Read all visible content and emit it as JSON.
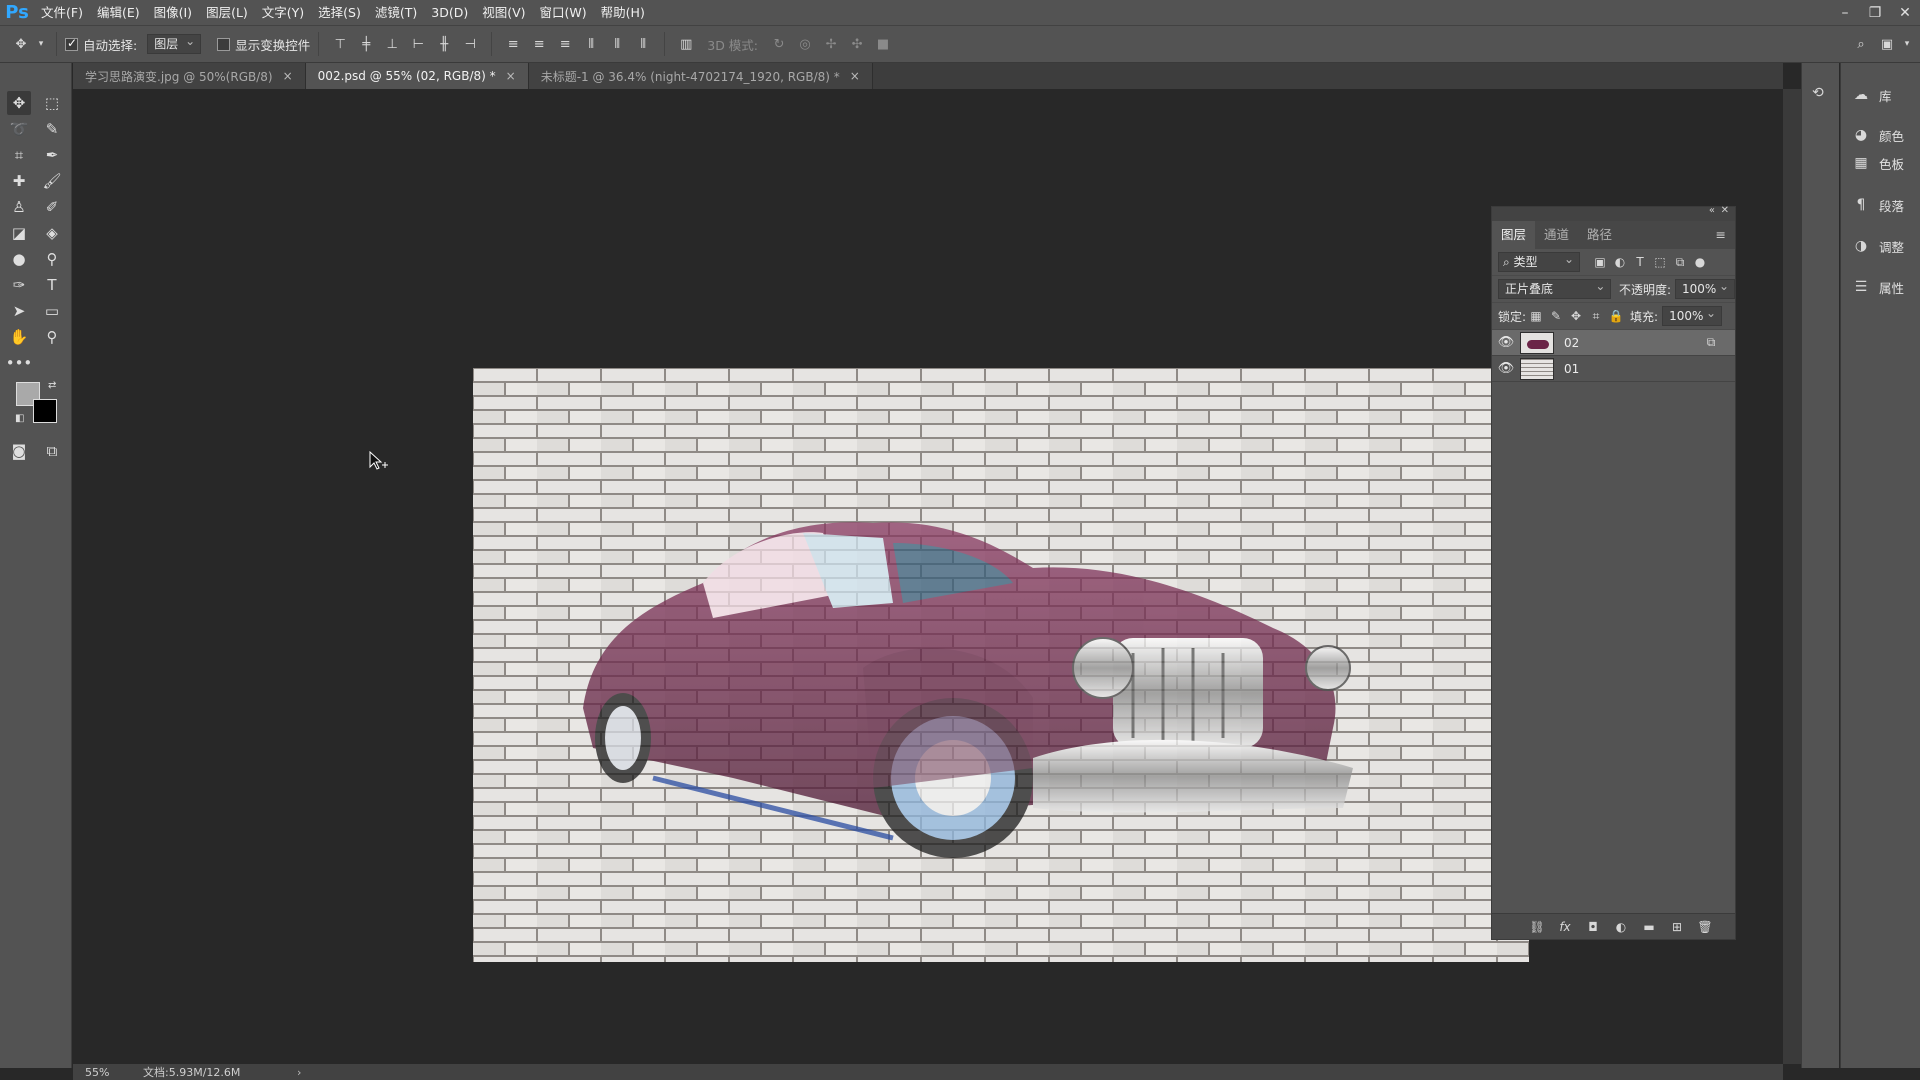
{
  "app": {
    "logo": "Ps"
  },
  "menu": [
    "文件(F)",
    "编辑(E)",
    "图像(I)",
    "图层(L)",
    "文字(Y)",
    "选择(S)",
    "滤镜(T)",
    "3D(D)",
    "视图(V)",
    "窗口(W)",
    "帮助(H)"
  ],
  "options": {
    "auto_select_label": "自动选择:",
    "auto_select_target": "图层",
    "show_transform_label": "显示变换控件",
    "mode_3d_label": "3D 模式:"
  },
  "tabs": [
    {
      "label": "学习思路演变.jpg @ 50%(RGB/8)",
      "close": "×"
    },
    {
      "label": "002.psd @ 55% (02, RGB/8) *",
      "close": "×"
    },
    {
      "label": "未标题-1 @ 36.4% (night-4702174_1920, RGB/8) *",
      "close": "×"
    }
  ],
  "status": {
    "zoom": "55%",
    "doc": "文档:5.93M/12.6M"
  },
  "layers_panel": {
    "tabs": [
      "图层",
      "通道",
      "路径"
    ],
    "filter_label": "类型",
    "blend_mode": "正片叠底",
    "opacity_label": "不透明度:",
    "opacity_value": "100%",
    "lock_label": "锁定:",
    "fill_label": "填充:",
    "fill_value": "100%",
    "layers": [
      {
        "name": "02",
        "visible": true,
        "selected": true
      },
      {
        "name": "01",
        "visible": true,
        "selected": false
      }
    ],
    "fx_label": "fx"
  },
  "dock": [
    {
      "label": "库",
      "icon": "libraries-icon"
    },
    {
      "label": "颜色",
      "icon": "color-icon"
    },
    {
      "label": "色板",
      "icon": "swatches-icon"
    },
    {
      "label": "段落",
      "icon": "paragraph-icon"
    },
    {
      "label": "调整",
      "icon": "adjustments-icon"
    },
    {
      "label": "属性",
      "icon": "properties-icon"
    }
  ],
  "colors": {
    "accent": "#31a8ff",
    "car_body": "#6b2447",
    "brick": "#e6e4e2",
    "mortar": "#8f8a86"
  }
}
